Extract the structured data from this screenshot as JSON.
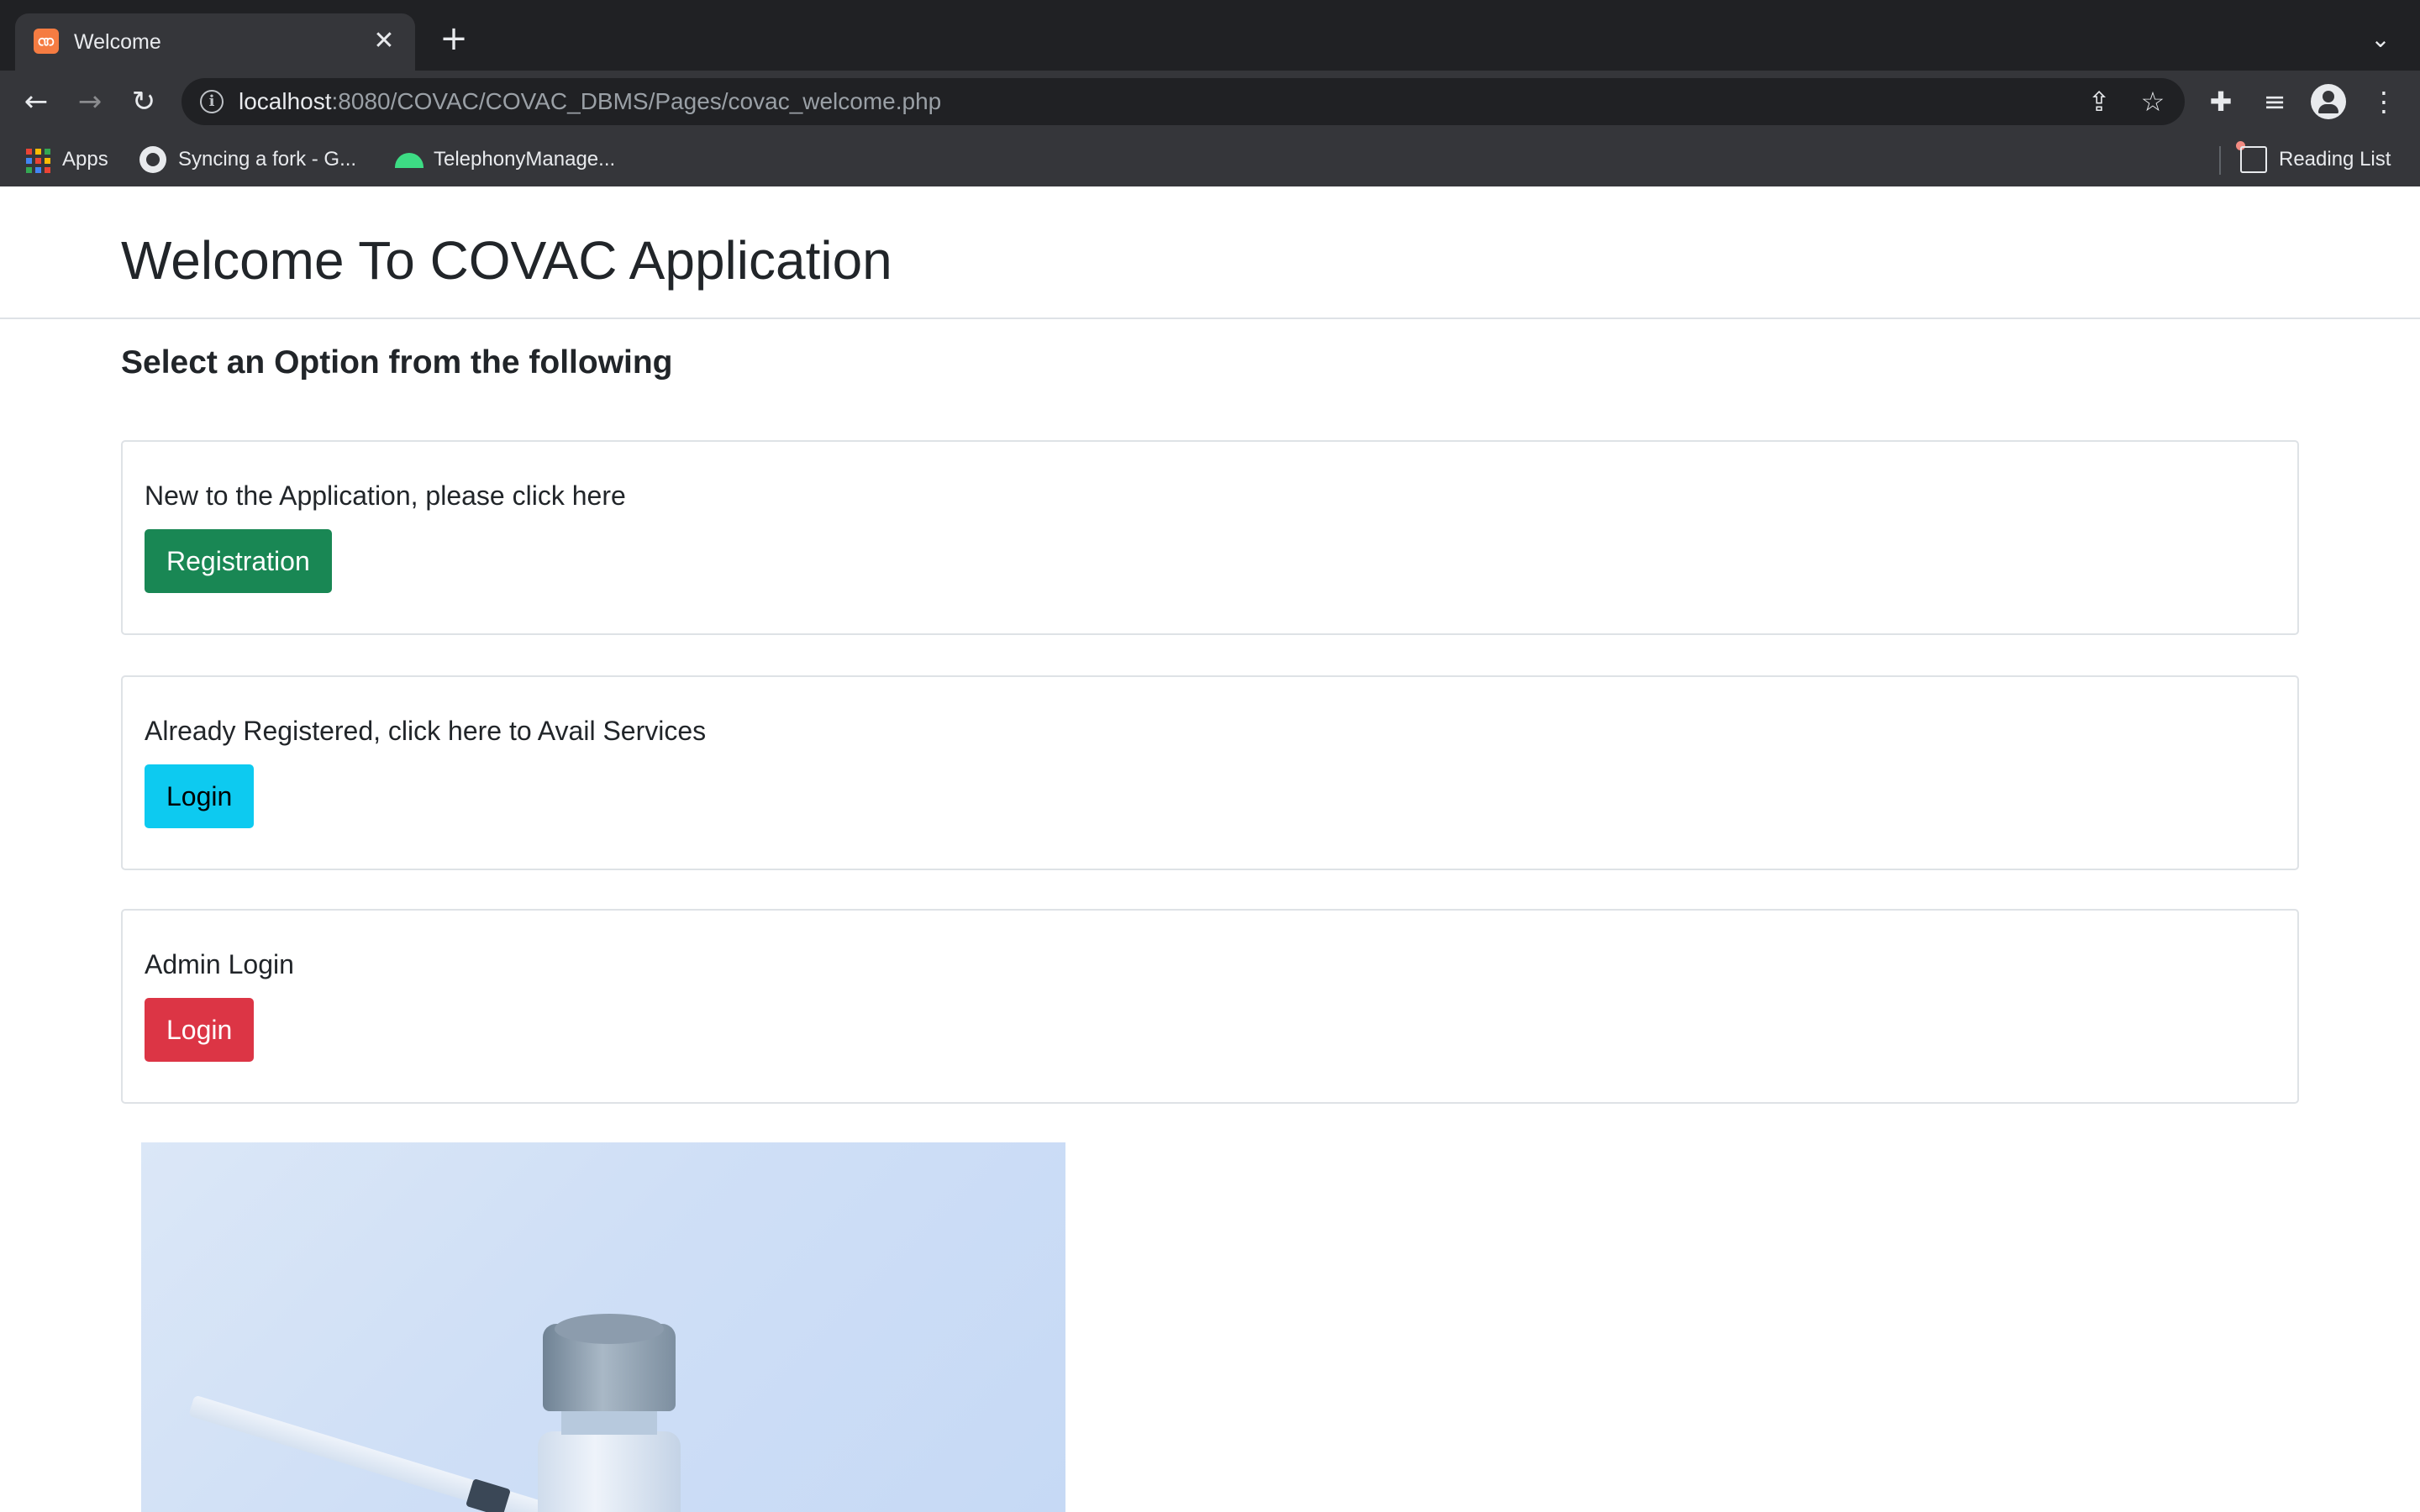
{
  "browser": {
    "tab": {
      "title": "Welcome"
    },
    "address": {
      "host": "localhost",
      "path": ":8080/COVAC/COVAC_DBMS/Pages/covac_welcome.php"
    },
    "bookmarks": [
      {
        "label": "Apps",
        "icon": "apps-grid-icon"
      },
      {
        "label": "Syncing a fork - G...",
        "icon": "github-icon"
      },
      {
        "label": "TelephonyManage...",
        "icon": "android-icon"
      }
    ],
    "reading_list": "Reading List"
  },
  "page": {
    "title": "Welcome To COVAC Application",
    "subtitle": "Select an Option from the following",
    "cards": [
      {
        "text": "New to the Application, please click here",
        "button": "Registration",
        "button_color": "#198754"
      },
      {
        "text": "Already Registered, click here to Avail Services",
        "button": "Login",
        "button_color": "#0dcaf0"
      },
      {
        "text": "Admin Login",
        "button": "Login",
        "button_color": "#dc3545"
      }
    ],
    "image": {
      "subject": "vaccine vial and syringe"
    }
  },
  "colors": {
    "apps_grid": [
      "#ea4335",
      "#fbbc04",
      "#34a853",
      "#4285f4",
      "#ea4335",
      "#fbbc04",
      "#34a853",
      "#4285f4",
      "#ea4335"
    ]
  }
}
